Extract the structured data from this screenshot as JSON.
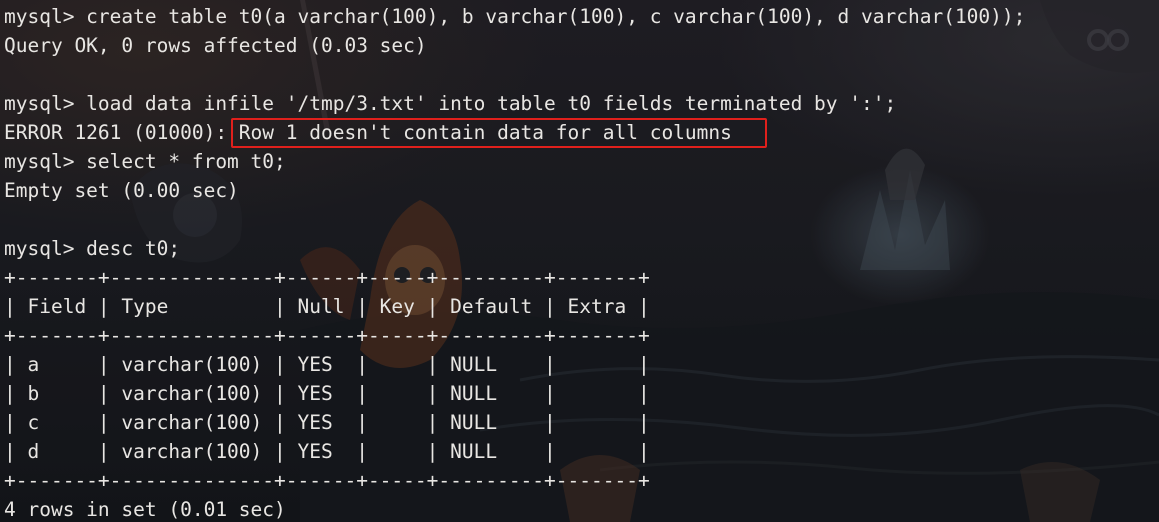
{
  "theme": {
    "text_color": "#e8e6e3",
    "background_color": "#1c1e24",
    "highlight_color": "#e0201c"
  },
  "terminal": {
    "lines": [
      "mysql> create table t0(a varchar(100), b varchar(100), c varchar(100), d varchar(100));",
      "Query OK, 0 rows affected (0.03 sec)",
      "",
      "mysql> load data infile '/tmp/3.txt' into table t0 fields terminated by ':';",
      "ERROR 1261 (01000): Row 1 doesn't contain data for all columns",
      "mysql> select * from t0;",
      "Empty set (0.00 sec)",
      "",
      "mysql> desc t0;",
      "+-------+--------------+------+-----+---------+-------+",
      "| Field | Type         | Null | Key | Default | Extra |",
      "+-------+--------------+------+-----+---------+-------+",
      "| a     | varchar(100) | YES  |     | NULL    |       |",
      "| b     | varchar(100) | YES  |     | NULL    |       |",
      "| c     | varchar(100) | YES  |     | NULL    |       |",
      "| d     | varchar(100) | YES  |     | NULL    |       |",
      "+-------+--------------+------+-----+---------+-------+",
      "4 rows in set (0.01 sec)"
    ]
  }
}
